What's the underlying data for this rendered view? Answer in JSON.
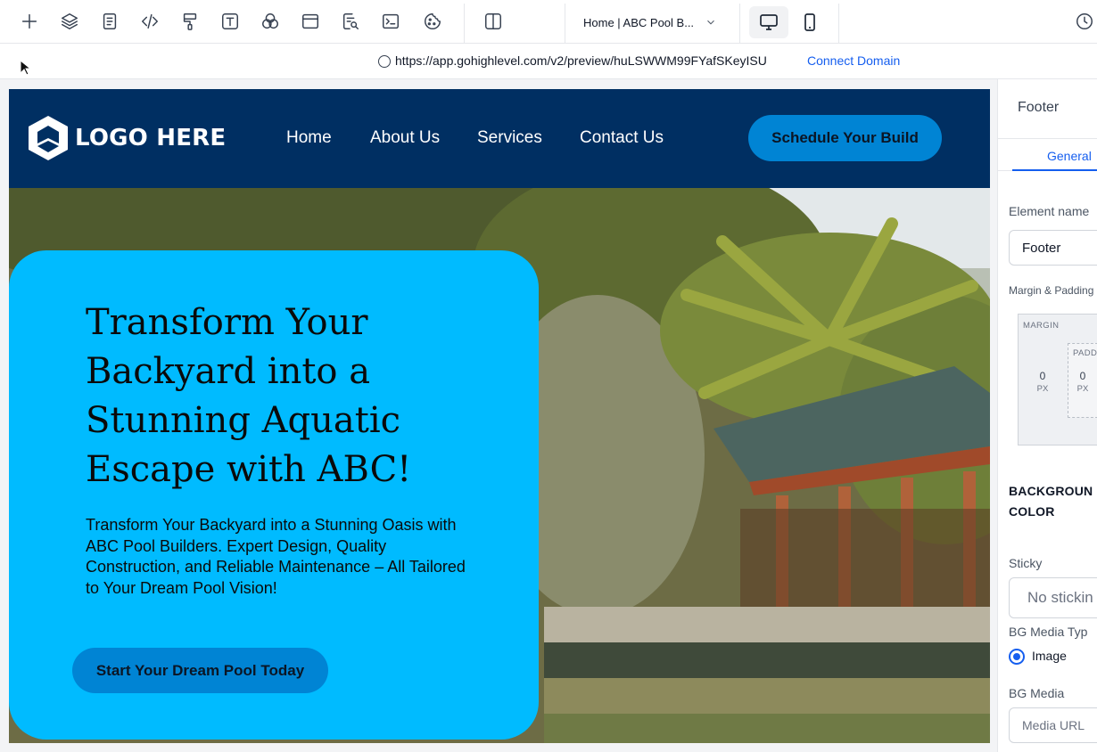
{
  "toolbar": {
    "page_selector": "Home | ABC Pool B...",
    "tools": [
      "add-icon",
      "layers-icon",
      "page-icon",
      "code-icon",
      "paint-roller-icon",
      "text-icon",
      "colors-icon",
      "section-icon",
      "search-doc-icon",
      "terminal-icon",
      "cookie-icon",
      "split-view-icon"
    ]
  },
  "urlbar": {
    "url": "https://app.gohighlevel.com/v2/preview/huLSWWM99FYafSKeyISU",
    "connect_domain": "Connect Domain"
  },
  "site": {
    "logo_text": "LOGO HERE",
    "nav": [
      "Home",
      "About Us",
      "Services",
      "Contact Us"
    ],
    "header_cta": "Schedule Your Build",
    "hero_title": "Transform Your Backyard into a Stunning Aquatic Escape with ABC!",
    "hero_subtitle": "Transform Your Backyard into a Stunning Oasis with ABC Pool Builders. Expert Design, Quality Construction, and Reliable Maintenance – All Tailored to Your Dream Pool Vision!",
    "hero_cta": "Start Your Dream Pool Today"
  },
  "panel": {
    "title": "Footer",
    "tab_general": "General",
    "element_name_label": "Element name",
    "element_name_value": "Footer",
    "margin_padding_label": "Margin & Padding",
    "margin_label": "MARGIN",
    "padding_label": "PADD",
    "margin_left_value": "0",
    "padding_left_value": "0",
    "unit": "PX",
    "bg_color_heading": "BACKGROUN\nCOLOR",
    "sticky_label": "Sticky",
    "sticky_value": "No stickin",
    "bg_media_type_label": "BG Media Typ",
    "bg_media_type_option": "Image",
    "bg_media_label": "BG Media",
    "bg_media_placeholder": "Media URL"
  },
  "colors": {
    "header_bg": "#002f62",
    "hero_card": "#00bbff",
    "cta": "#0084d4",
    "link_blue": "#155eef"
  }
}
